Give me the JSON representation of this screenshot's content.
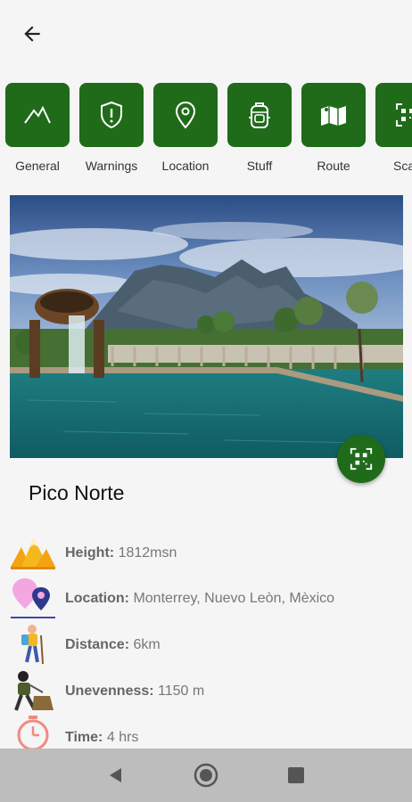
{
  "header": {
    "back_icon": "arrow-left-icon"
  },
  "tabs": [
    {
      "label": "General",
      "icon": "mountain-icon"
    },
    {
      "label": "Warnings",
      "icon": "shield-alert-icon"
    },
    {
      "label": "Location",
      "icon": "map-pin-icon"
    },
    {
      "label": "Stuff",
      "icon": "backpack-icon"
    },
    {
      "label": "Route",
      "icon": "map-route-icon"
    },
    {
      "label": "Scan",
      "icon": "qr-scan-icon"
    }
  ],
  "title": "Pico Norte",
  "details": [
    {
      "key": "Height:",
      "value": "1812msn",
      "icon": "mountain-peaks-icon"
    },
    {
      "key": "Location:",
      "value": "Monterrey, Nuevo Leòn, Mèxico",
      "icon": "map-pins-icon"
    },
    {
      "key": "Distance:",
      "value": "6km",
      "icon": "hiker-icon"
    },
    {
      "key": "Unevenness:",
      "value": "1150 m",
      "icon": "climber-icon"
    },
    {
      "key": "Time:",
      "value": "4 hrs",
      "icon": "stopwatch-icon"
    }
  ],
  "colors": {
    "accent": "#1f6b1a",
    "background": "#f5f5f5",
    "navbar": "#bdbdbd"
  }
}
